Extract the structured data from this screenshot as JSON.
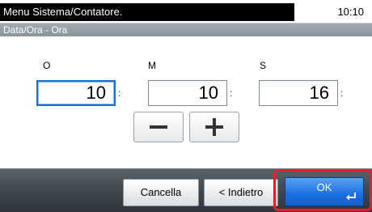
{
  "header": {
    "title": "Menu Sistema/Contatore.",
    "clock": "10:10"
  },
  "subheader": {
    "title": "Data/Ora - Ora"
  },
  "time_fields": [
    {
      "label": "O",
      "value": "10",
      "selected": true
    },
    {
      "label": "M",
      "value": "10",
      "selected": false
    },
    {
      "label": "S",
      "value": "16",
      "selected": false
    }
  ],
  "separator": ":",
  "stepper": {
    "decrement_icon": "minus-icon",
    "increment_icon": "plus-icon"
  },
  "footer": {
    "cancel_label": "Cancella",
    "back_label": "< Indietro",
    "ok_label": "OK",
    "ok_icon": "enter-icon"
  },
  "colors": {
    "accent": "#1b6ee0",
    "highlight": "#e0202a",
    "title_bar": "#000000"
  }
}
